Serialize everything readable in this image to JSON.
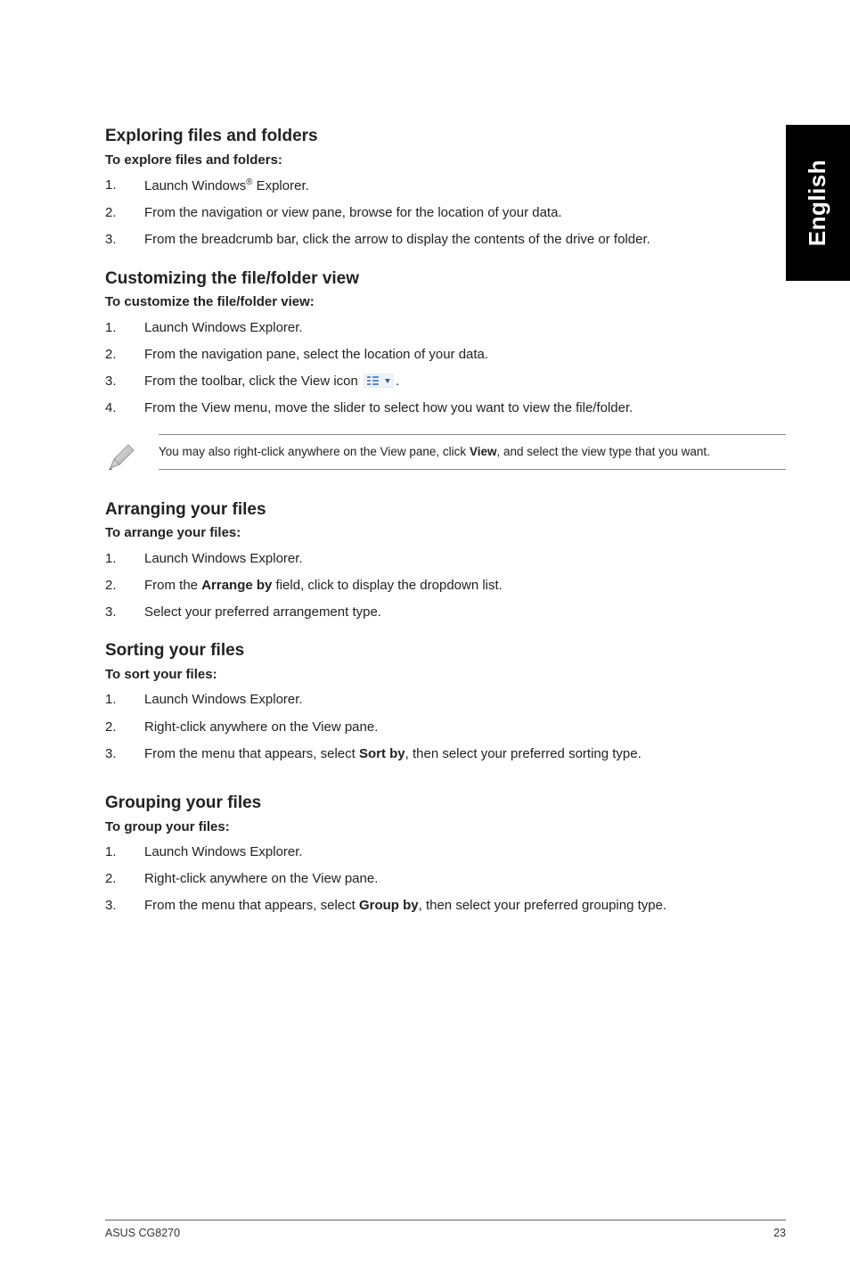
{
  "side_tab": "English",
  "sections": {
    "explore": {
      "title": "Exploring files and folders",
      "sub": "To explore files and folders:",
      "steps": [
        {
          "n": "1.",
          "pre": "Launch Windows",
          "sup": "®",
          "post": " Explorer."
        },
        {
          "n": "2.",
          "text": "From the navigation or view pane, browse for the location of your data."
        },
        {
          "n": "3.",
          "text": "From the breadcrumb bar, click the arrow to display the contents of the drive or folder."
        }
      ]
    },
    "customize": {
      "title": "Customizing the file/folder view",
      "sub": "To customize the file/folder view:",
      "steps": [
        {
          "n": "1.",
          "text": "Launch Windows Explorer."
        },
        {
          "n": "2.",
          "text": "From the navigation pane, select the location of your data."
        },
        {
          "n": "3.",
          "pre": "From the toolbar, click the View icon ",
          "icon": true,
          "post": "."
        },
        {
          "n": "4.",
          "text": "From the View menu, move the slider to select how you want to view the file/folder."
        }
      ]
    },
    "note": {
      "pre": "You may also right-click anywhere on the View pane, click ",
      "bold": "View",
      "post": ", and select the view type that you want."
    },
    "arrange": {
      "title": "Arranging your files",
      "sub": "To arrange your files:",
      "steps": [
        {
          "n": "1.",
          "text": "Launch Windows Explorer."
        },
        {
          "n": "2.",
          "pre": "From the ",
          "bold": "Arrange by",
          "post": " field, click to display the dropdown list."
        },
        {
          "n": "3.",
          "text": "Select your preferred arrangement type."
        }
      ]
    },
    "sort": {
      "title": "Sorting your files",
      "sub": "To sort your files:",
      "steps": [
        {
          "n": "1.",
          "text": "Launch Windows Explorer."
        },
        {
          "n": "2.",
          "text": "Right-click anywhere on the View pane."
        },
        {
          "n": "3.",
          "pre": "From the menu that appears, select ",
          "bold": "Sort by",
          "post": ", then select your preferred sorting type."
        }
      ]
    },
    "group": {
      "title": "Grouping your files",
      "sub": "To group your files:",
      "steps": [
        {
          "n": "1.",
          "text": "Launch Windows Explorer."
        },
        {
          "n": "2.",
          "text": "Right-click anywhere on the View pane."
        },
        {
          "n": "3.",
          "pre": "From the menu that appears, select ",
          "bold": "Group by",
          "post": ", then select your preferred grouping type."
        }
      ]
    }
  },
  "footer": {
    "left": "ASUS CG8270",
    "right": "23"
  }
}
